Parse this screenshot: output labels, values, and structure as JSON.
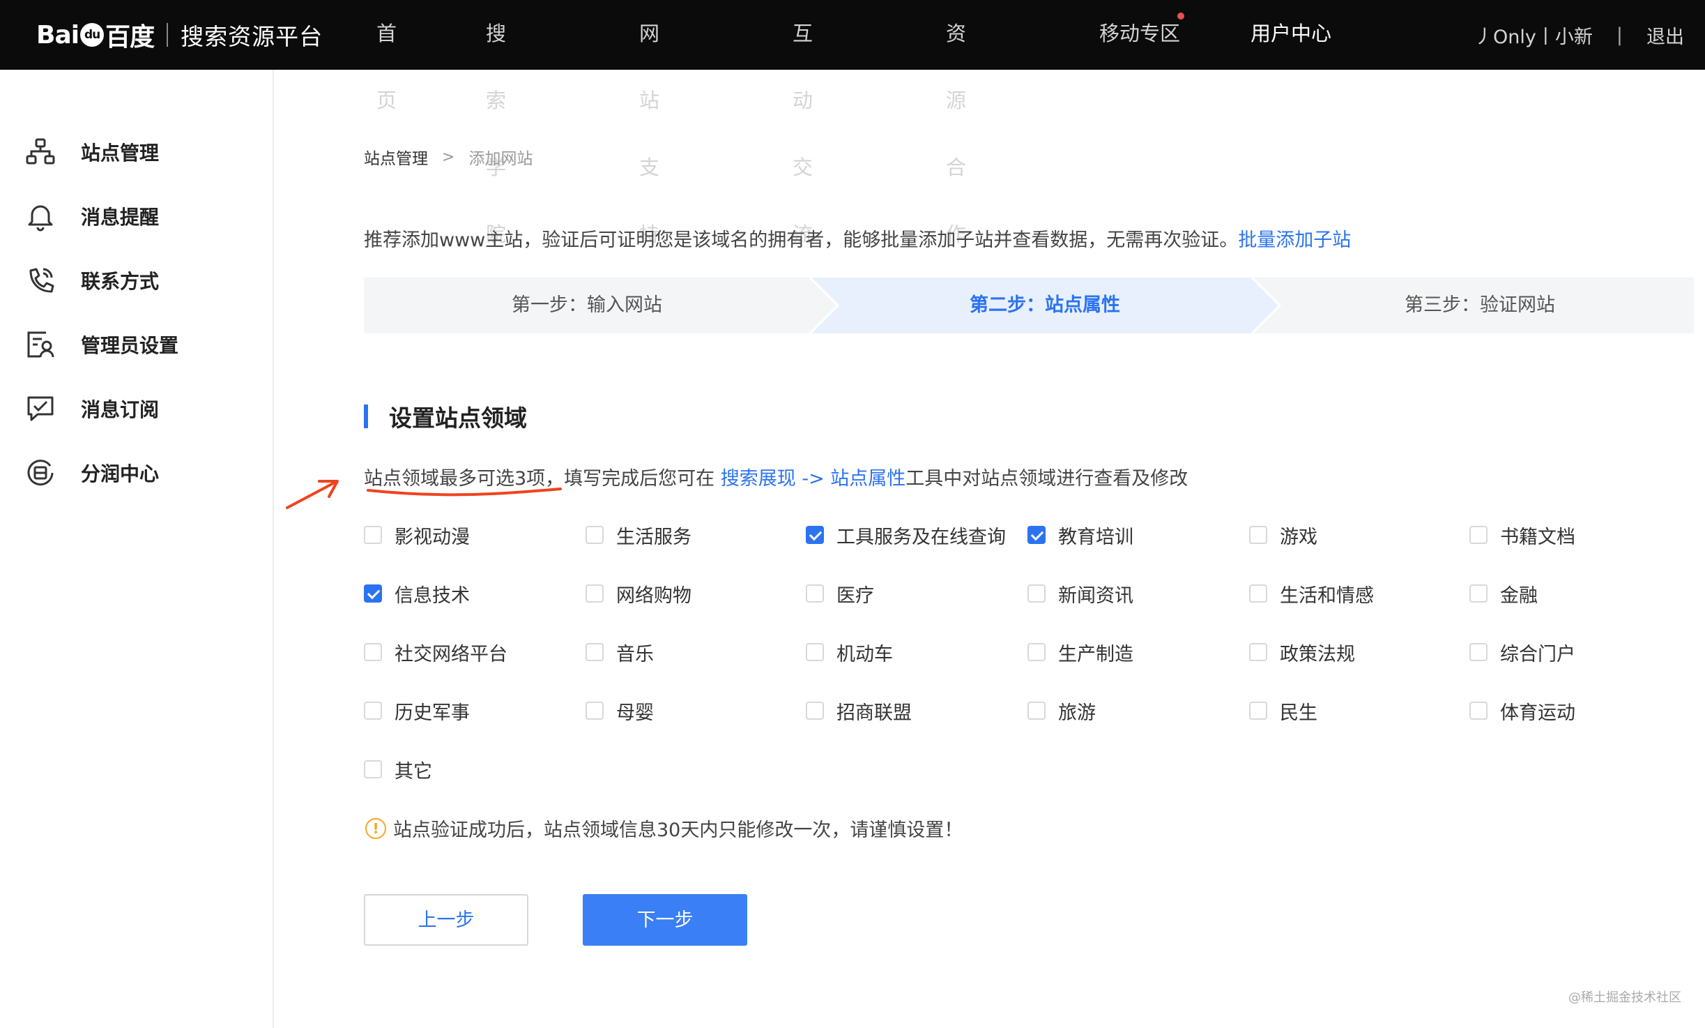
{
  "header": {
    "logo_text": "Bai",
    "logo_paw": "du",
    "logo_text2": "百度",
    "platform_title": "搜索资源平台",
    "nav": [
      {
        "label": "首页"
      },
      {
        "label": "搜索学院"
      },
      {
        "label": "网站支持"
      },
      {
        "label": "互动交流"
      },
      {
        "label": "资源合作"
      },
      {
        "label": "移动专区"
      },
      {
        "label": "用户中心"
      }
    ],
    "username": "丿Only丨小新",
    "divider": "|",
    "logout": "退出"
  },
  "sidebar": {
    "items": [
      {
        "label": "站点管理",
        "icon": "sitemap-icon"
      },
      {
        "label": "消息提醒",
        "icon": "bell-icon"
      },
      {
        "label": "联系方式",
        "icon": "phone-icon"
      },
      {
        "label": "管理员设置",
        "icon": "admin-icon"
      },
      {
        "label": "消息订阅",
        "icon": "subscribe-icon"
      },
      {
        "label": "分润中心",
        "icon": "share-icon"
      }
    ]
  },
  "breadcrumb": {
    "home": "站点管理",
    "separator": ">",
    "current": "添加网站"
  },
  "intro": {
    "text": "推荐添加www主站，验证后可证明您是该域名的拥有者，能够批量添加子站并查看数据，无需再次验证。",
    "link": "批量添加子站"
  },
  "steps": [
    {
      "label": "第一步：输入网站"
    },
    {
      "label": "第二步：站点属性"
    },
    {
      "label": "第三步：验证网站"
    }
  ],
  "section": {
    "title": "设置站点领域",
    "hint_part1": "站点领域最多可选3项，填写完成后您可在 ",
    "hint_link": "搜索展现 -> 站点属性",
    "hint_part2": "工具中对站点领域进行查看及修改"
  },
  "categories": [
    {
      "label": "影视动漫",
      "checked": false
    },
    {
      "label": "生活服务",
      "checked": false
    },
    {
      "label": "工具服务及在线查询",
      "checked": true
    },
    {
      "label": "教育培训",
      "checked": true
    },
    {
      "label": "游戏",
      "checked": false
    },
    {
      "label": "书籍文档",
      "checked": false
    },
    {
      "label": "信息技术",
      "checked": true
    },
    {
      "label": "网络购物",
      "checked": false
    },
    {
      "label": "医疗",
      "checked": false
    },
    {
      "label": "新闻资讯",
      "checked": false
    },
    {
      "label": "生活和情感",
      "checked": false
    },
    {
      "label": "金融",
      "checked": false
    },
    {
      "label": "社交网络平台",
      "checked": false
    },
    {
      "label": "音乐",
      "checked": false
    },
    {
      "label": "机动车",
      "checked": false
    },
    {
      "label": "生产制造",
      "checked": false
    },
    {
      "label": "政策法规",
      "checked": false
    },
    {
      "label": "综合门户",
      "checked": false
    },
    {
      "label": "历史军事",
      "checked": false
    },
    {
      "label": "母婴",
      "checked": false
    },
    {
      "label": "招商联盟",
      "checked": false
    },
    {
      "label": "旅游",
      "checked": false
    },
    {
      "label": "民生",
      "checked": false
    },
    {
      "label": "体育运动",
      "checked": false
    },
    {
      "label": "其它",
      "checked": false
    }
  ],
  "warning": {
    "icon": "!",
    "text": "站点验证成功后，站点领域信息30天内只能修改一次，请谨慎设置！"
  },
  "buttons": {
    "prev": "上一步",
    "next": "下一步"
  },
  "watermark": "@稀土掘金技术社区",
  "colors": {
    "accent": "#2b73f0",
    "header_bg": "#0b0b0b",
    "annotation_red": "#f0431f",
    "warning": "#f5a623"
  }
}
